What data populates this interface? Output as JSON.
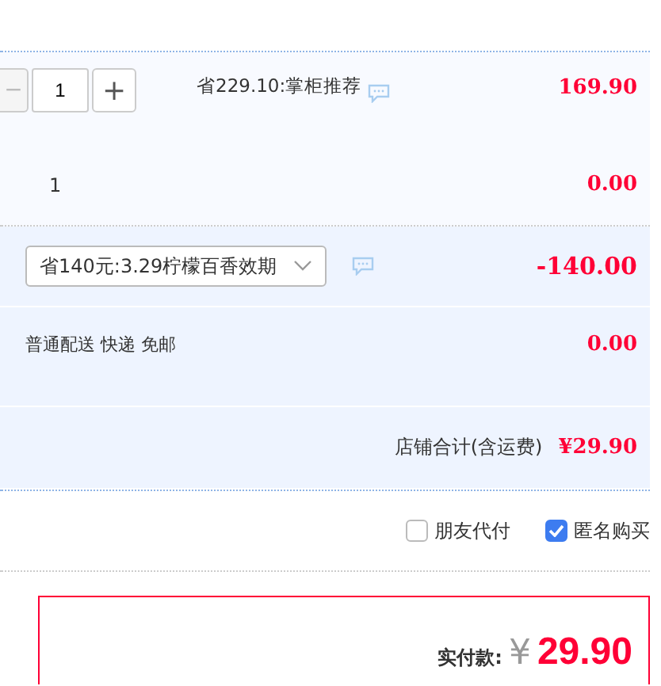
{
  "item": {
    "minus": "−",
    "quantity": "1",
    "plus": "+",
    "promo": "省229.10:掌柜推荐",
    "price": "169.90"
  },
  "gift": {
    "quantity": "1",
    "price": "0.00"
  },
  "discount": {
    "value": "省140元:3.29柠檬百香效期",
    "amount": "-140.00"
  },
  "shipping": {
    "label": "普通配送 快递 免邮",
    "price": "0.00"
  },
  "shop_total": {
    "label": "店铺合计(含运费)",
    "amount": "¥29.90"
  },
  "options": [
    {
      "label": "朋友代付",
      "checked": false
    },
    {
      "label": "匿名购买",
      "checked": true
    }
  ],
  "payment": {
    "label": "实付款:",
    "currency": "¥",
    "amount": "29.90"
  }
}
